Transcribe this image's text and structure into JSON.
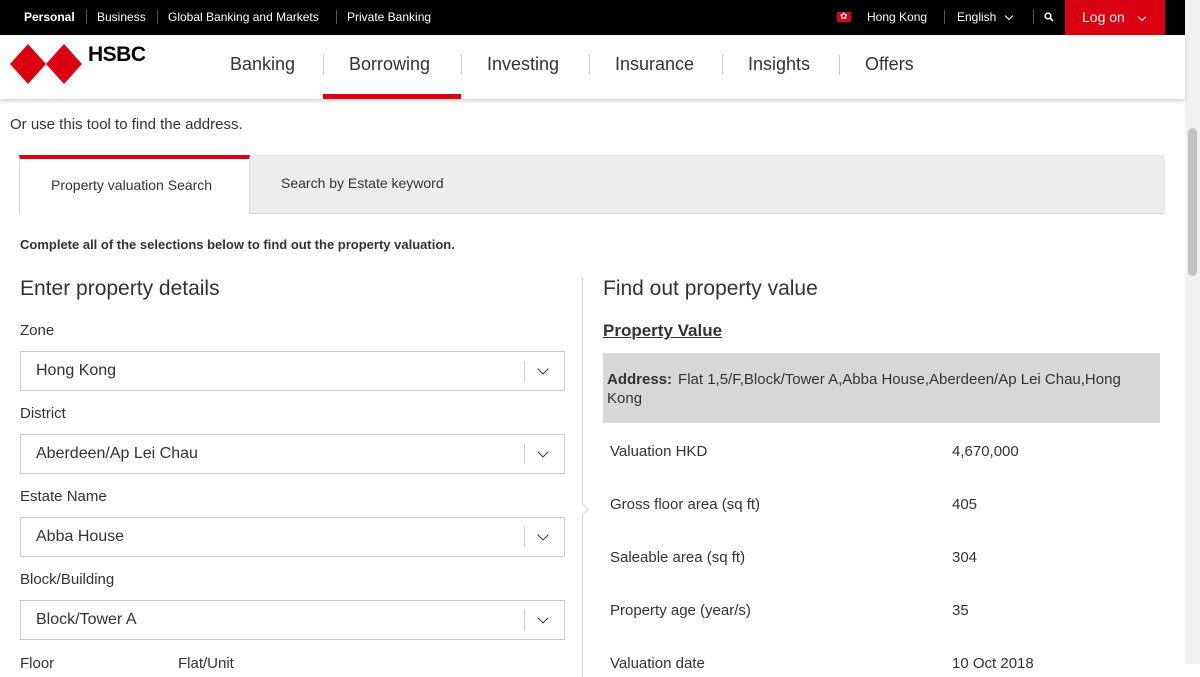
{
  "topbar": {
    "segments": [
      "Personal",
      "Business",
      "Global Banking and Markets",
      "Private Banking"
    ],
    "region": "Hong Kong",
    "language": "English",
    "logon": "Log on"
  },
  "header": {
    "logo_text": "HSBC",
    "nav": [
      "Banking",
      "Borrowing",
      "Investing",
      "Insurance",
      "Insights",
      "Offers"
    ],
    "active_nav": "Borrowing"
  },
  "colors": {
    "brand": "#db0011",
    "topbar": "#000000",
    "address_bg": "#d7d7d7"
  },
  "intro": "Or use this tool to find the address.",
  "tabs": [
    "Property valuation Search",
    "Search by Estate keyword"
  ],
  "instruction": "Complete all of the selections below to find out the property valuation.",
  "left": {
    "title": "Enter property details",
    "fields": [
      {
        "label": "Zone",
        "value": "Hong Kong"
      },
      {
        "label": "District",
        "value": "Aberdeen/Ap Lei Chau"
      },
      {
        "label": "Estate Name",
        "value": "Abba House"
      },
      {
        "label": "Block/Building",
        "value": "Block/Tower A"
      }
    ],
    "floor_label": "Floor",
    "flat_label": "Flat/Unit"
  },
  "right": {
    "title": "Find out property value",
    "subtitle": "Property Value",
    "address_label": "Address:",
    "address": "Flat 1,5/F,Block/Tower A,Abba House,Aberdeen/Ap Lei Chau,Hong Kong",
    "rows": [
      {
        "label": "Valuation HKD",
        "value": "4,670,000"
      },
      {
        "label": "Gross floor area (sq ft)",
        "value": "405"
      },
      {
        "label": "Saleable area (sq ft)",
        "value": "304"
      },
      {
        "label": "Property age (year/s)",
        "value": "35"
      },
      {
        "label": "Valuation date",
        "value": "10 Oct 2018"
      }
    ]
  }
}
